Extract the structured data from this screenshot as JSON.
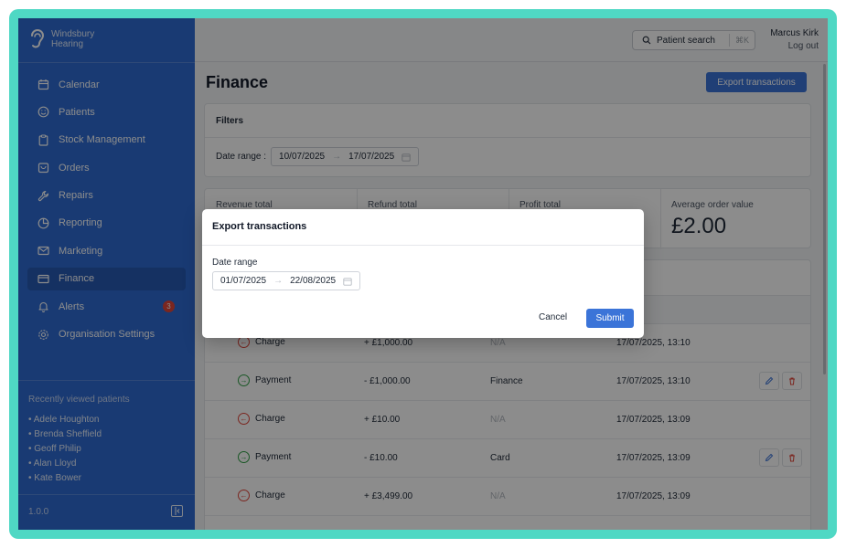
{
  "brand": {
    "line1": "Windsbury",
    "line2": "Hearing"
  },
  "nav": [
    {
      "label": "Calendar",
      "icon": "calendar-icon"
    },
    {
      "label": "Patients",
      "icon": "smile-icon"
    },
    {
      "label": "Stock Management",
      "icon": "clipboard-icon"
    },
    {
      "label": "Orders",
      "icon": "bag-icon"
    },
    {
      "label": "Repairs",
      "icon": "wrench-icon"
    },
    {
      "label": "Reporting",
      "icon": "pie-chart-icon"
    },
    {
      "label": "Marketing",
      "icon": "mail-icon"
    },
    {
      "label": "Finance",
      "icon": "card-icon",
      "active": true
    },
    {
      "label": "Alerts",
      "icon": "bell-icon",
      "badge": "3"
    },
    {
      "label": "Organisation Settings",
      "icon": "gear-icon"
    }
  ],
  "recent": {
    "title": "Recently viewed patients",
    "patients": [
      "• Adele Houghton",
      "• Brenda Sheffield",
      "• Geoff Philip",
      "• Alan Lloyd",
      "• Kate Bower"
    ]
  },
  "version": "1.0.0",
  "topbar": {
    "search_label": "Patient search",
    "search_kbd": "⌘K",
    "user_name": "Marcus Kirk",
    "logout": "Log out"
  },
  "page": {
    "title": "Finance",
    "export_label": "Export transactions"
  },
  "filters": {
    "title": "Filters",
    "date_label": "Date range :",
    "start": "10/07/2025",
    "end": "17/07/2025"
  },
  "stats": [
    {
      "label": "Revenue total",
      "value": ""
    },
    {
      "label": "Refund total",
      "value": ""
    },
    {
      "label": "Profit total",
      "value": ""
    },
    {
      "label": "Average order value",
      "value": "£2.00"
    }
  ],
  "table": {
    "header_partial": "d",
    "rows": [
      {
        "type": "Charge",
        "amount": "+ £1,000.00",
        "method": "N/A",
        "date": "17/07/2025, 13:10",
        "actions": false
      },
      {
        "type": "Payment",
        "amount": "- £1,000.00",
        "method": "Finance",
        "date": "17/07/2025, 13:10",
        "actions": true
      },
      {
        "type": "Charge",
        "amount": "+ £10.00",
        "method": "N/A",
        "date": "17/07/2025, 13:09",
        "actions": false
      },
      {
        "type": "Payment",
        "amount": "- £10.00",
        "method": "Card",
        "date": "17/07/2025, 13:09",
        "actions": true
      },
      {
        "type": "Charge",
        "amount": "+ £3,499.00",
        "method": "N/A",
        "date": "17/07/2025, 13:09",
        "actions": false
      }
    ]
  },
  "modal": {
    "title": "Export transactions",
    "date_label": "Date range",
    "start": "01/07/2025",
    "end": "22/08/2025",
    "cancel": "Cancel",
    "submit": "Submit"
  },
  "colors": {
    "sidebar": "#2f6bd1",
    "accent": "#3b74d8",
    "badge": "#e0453a",
    "frame": "#4fd8c4"
  }
}
